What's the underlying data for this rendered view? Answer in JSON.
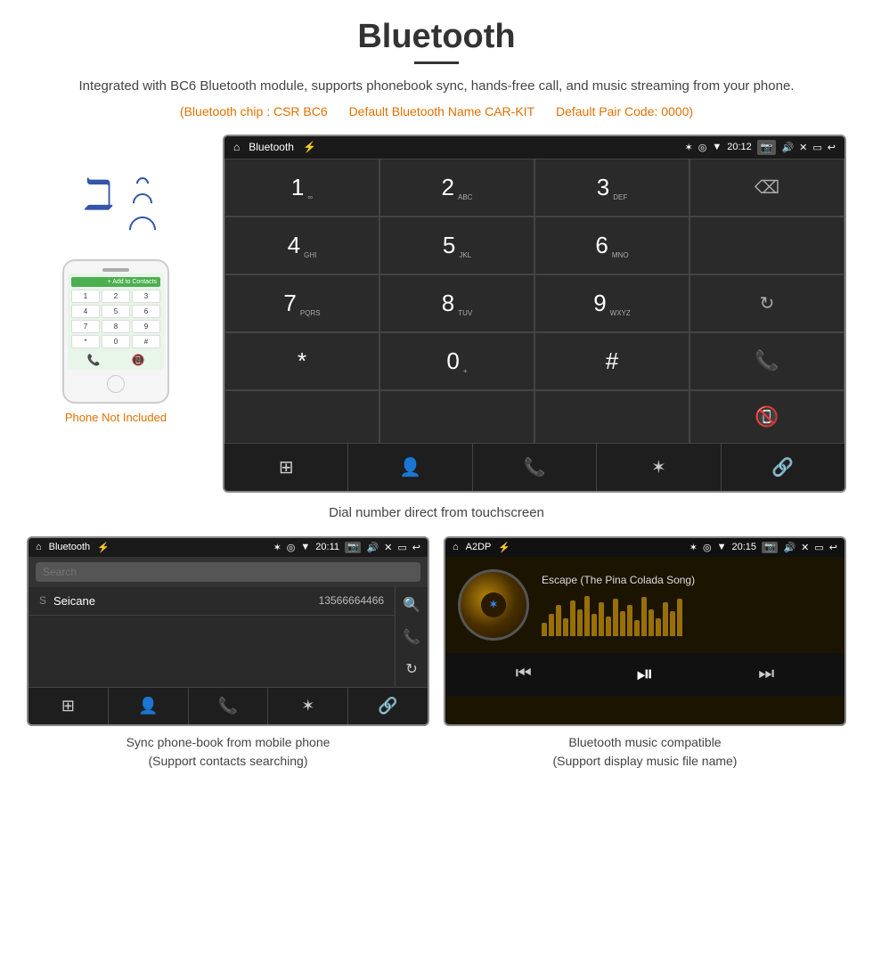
{
  "page": {
    "title": "Bluetooth",
    "description": "Integrated with BC6 Bluetooth module, supports phonebook sync, hands-free call, and music streaming from your phone.",
    "specs": {
      "chip": "(Bluetooth chip : CSR BC6",
      "name": "Default Bluetooth Name CAR-KIT",
      "code": "Default Pair Code: 0000)"
    }
  },
  "phone_side": {
    "not_included": "Phone Not Included"
  },
  "dialpad_screen": {
    "statusbar": {
      "app_name": "Bluetooth",
      "time": "20:12"
    },
    "keys": [
      {
        "num": "1",
        "sub": "∞"
      },
      {
        "num": "2",
        "sub": "ABC"
      },
      {
        "num": "3",
        "sub": "DEF"
      },
      {
        "num": "4",
        "sub": "GHI"
      },
      {
        "num": "5",
        "sub": "JKL"
      },
      {
        "num": "6",
        "sub": "MNO"
      },
      {
        "num": "7",
        "sub": "PQRS"
      },
      {
        "num": "8",
        "sub": "TUV"
      },
      {
        "num": "9",
        "sub": "WXYZ"
      },
      {
        "num": "*",
        "sub": ""
      },
      {
        "num": "0",
        "sub": "+"
      },
      {
        "num": "#",
        "sub": ""
      }
    ],
    "caption": "Dial number direct from touchscreen"
  },
  "phonebook_screen": {
    "statusbar": {
      "app_name": "Bluetooth",
      "time": "20:11"
    },
    "search_placeholder": "Search",
    "contacts": [
      {
        "letter": "S",
        "name": "Seicane",
        "number": "13566664466"
      }
    ],
    "bottom_caption": "Sync phone-book from mobile phone\n(Support contacts searching)"
  },
  "music_screen": {
    "statusbar": {
      "app_name": "A2DP",
      "time": "20:15"
    },
    "song_title": "Escape (The Pina Colada Song)",
    "bottom_caption": "Bluetooth music compatible\n(Support display music file name)"
  },
  "waveform_heights": [
    15,
    25,
    35,
    20,
    40,
    30,
    45,
    25,
    38,
    22,
    42,
    28,
    35,
    18,
    44,
    30,
    20,
    38,
    28,
    42
  ],
  "phonebook_small_keys": [
    "1",
    "2",
    "3",
    "4",
    "5",
    "6",
    "7",
    "8",
    "9",
    "*",
    "0",
    "#"
  ],
  "colors": {
    "accent_orange": "#e07000",
    "bt_blue": "#3355aa",
    "android_dark": "#2a2a2a",
    "green_call": "#4CAF50",
    "red_call": "#e53935"
  }
}
